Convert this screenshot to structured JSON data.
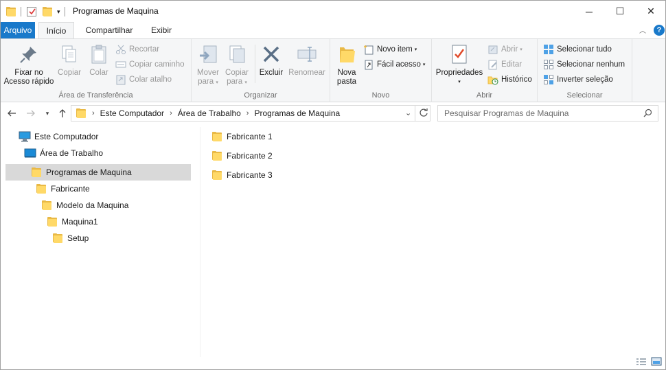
{
  "window": {
    "title": "Programas de Maquina",
    "minimize": "─",
    "maximize": "☐",
    "close": "✕"
  },
  "tabs": {
    "file": "Arquivo",
    "home": "Início",
    "share": "Compartilhar",
    "view": "Exibir"
  },
  "ribbon": {
    "clipboard": {
      "label": "Área de Transferência",
      "pin_line1": "Fixar no",
      "pin_line2": "Acesso rápido",
      "copy": "Copiar",
      "paste": "Colar",
      "cut": "Recortar",
      "copy_path": "Copiar caminho",
      "paste_shortcut": "Colar atalho"
    },
    "organize": {
      "label": "Organizar",
      "move_line1": "Mover",
      "move_line2": "para",
      "copy_line1": "Copiar",
      "copy_line2": "para",
      "delete": "Excluir",
      "rename": "Renomear"
    },
    "new": {
      "label": "Novo",
      "new_folder_line1": "Nova",
      "new_folder_line2": "pasta",
      "new_item": "Novo item",
      "easy_access": "Fácil acesso"
    },
    "open": {
      "label": "Abrir",
      "properties": "Propriedades",
      "open": "Abrir",
      "edit": "Editar",
      "history": "Histórico"
    },
    "select": {
      "label": "Selecionar",
      "select_all": "Selecionar tudo",
      "select_none": "Selecionar nenhum",
      "invert": "Inverter seleção"
    }
  },
  "address": {
    "crumbs": [
      "Este Computador",
      "Área de Trabalho",
      "Programas de Maquina"
    ],
    "search_placeholder": "Pesquisar Programas de Maquina"
  },
  "tree": [
    {
      "label": "Este Computador",
      "icon": "computer-icon"
    },
    {
      "label": "Área de Trabalho",
      "icon": "desktop-icon"
    },
    {
      "label": "Programas de Maquina",
      "icon": "folder-icon",
      "selected": true
    },
    {
      "label": "Fabricante",
      "icon": "folder-icon"
    },
    {
      "label": "Modelo da Maquina",
      "icon": "folder-icon"
    },
    {
      "label": "Maquina1",
      "icon": "folder-icon"
    },
    {
      "label": "Setup",
      "icon": "folder-icon"
    }
  ],
  "files": [
    {
      "name": "Fabricante 1"
    },
    {
      "name": "Fabricante 2"
    },
    {
      "name": "Fabricante 3"
    }
  ],
  "colors": {
    "accent": "#1979ca",
    "selection": "#d9d9d9",
    "folder": "#ffd968"
  }
}
